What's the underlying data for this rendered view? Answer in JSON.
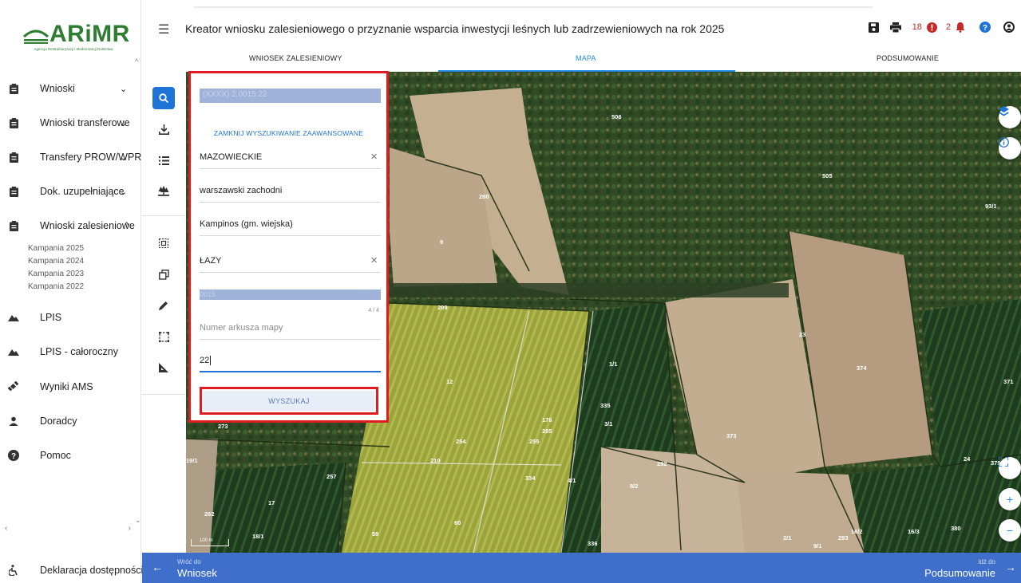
{
  "logo": {
    "brand": "ARiMR",
    "subtitle": "Agencja Restrukturyzacji i Modernizacji Rolnictwa"
  },
  "sidebar": {
    "items": [
      {
        "label": "Wnioski",
        "caret": "⌄"
      },
      {
        "label": "Wnioski transferowe",
        "caret": "⌄"
      },
      {
        "label": "Transfery PROW/WPR",
        "caret": "⌄"
      },
      {
        "label": "Dok. uzupełniające",
        "caret": "⌄"
      },
      {
        "label": "Wnioski zalesieniowe",
        "caret": "^"
      },
      {
        "label": "LPIS"
      },
      {
        "label": "LPIS - całoroczny"
      },
      {
        "label": "Wyniki AMS"
      },
      {
        "label": "Doradcy"
      },
      {
        "label": "Pomoc"
      }
    ],
    "subitems": [
      "Kampania 2025",
      "Kampania 2024",
      "Kampania 2023",
      "Kampania 2022"
    ],
    "footer": "Deklaracja dostępności"
  },
  "header": {
    "title": "Kreator wniosku zalesieniowego o przyznanie wsparcia inwestycji leśnych lub zadrzewieniowych na rok 2025",
    "count_a": "18",
    "count_b": "2",
    "tabs": [
      "WNIOSEK ZALESIENIOWY",
      "MAPA",
      "PODSUMOWANIE"
    ],
    "active_tab": "MAPA"
  },
  "search": {
    "placeholder": "(XXXX) 2.0015.22",
    "advanced_link": "ZAMKNIJ WYSZUKIWANIE ZAAWANSOWANE",
    "voivodeship": "MAZOWIECKIE",
    "county": "warszawski zachodni",
    "commune": "Kampinos (gm. wiejska)",
    "precinct": "ŁAZY",
    "disabled_value": "0015",
    "counter": "4 / 4",
    "sheet_placeholder": "Numer arkusza mapy",
    "parcel_value": "22",
    "submit_label": "WYSZUKAJ"
  },
  "map": {
    "scale_label": "100 m",
    "parcel_numbers": [
      "506",
      "505",
      "93/1",
      "280",
      "9",
      "209",
      "23",
      "374",
      "371",
      "12",
      "1/1",
      "335",
      "3/1",
      "176",
      "285",
      "255",
      "254",
      "373",
      "24",
      "379",
      "19/1",
      "210",
      "257",
      "334",
      "4/1",
      "8/2",
      "292",
      "17",
      "262",
      "60",
      "59",
      "18/1",
      "336",
      "2/1",
      "9/1",
      "293",
      "16/2",
      "16/3",
      "380",
      "273"
    ]
  },
  "footer_nav": {
    "back_small": "Wróć do",
    "back_big": "Wniosek",
    "next_small": "Idź do",
    "next_big": "Podsumowanie"
  },
  "colors": {
    "accent": "#1e73d7",
    "highlight": "#e11b22",
    "bottombar": "#3f6fcb",
    "brand_green": "#2e7d32"
  }
}
